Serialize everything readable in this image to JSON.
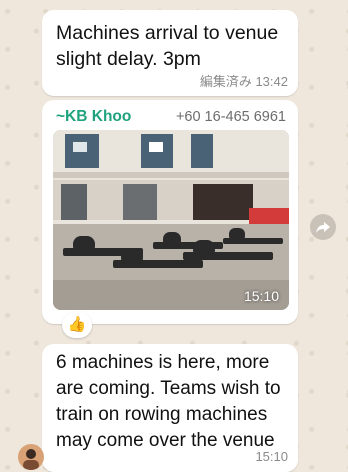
{
  "messages": [
    {
      "text": "Machines arrival to venue slight delay. 3pm",
      "edited_label": "編集済み",
      "time": "13:42"
    },
    {
      "sender": "~KB Khoo",
      "phone": "+60 16-465 6961",
      "image_time": "15:10",
      "reaction": "👍"
    },
    {
      "text": "6 machines is here, more are coming.  Teams wish to train on rowing machines may come over the venue",
      "time": "15:10"
    }
  ],
  "icons": {
    "forward": "forward-arrow-icon",
    "reaction": "thumbs-up-icon",
    "avatar": "sender-avatar"
  },
  "colors": {
    "chat_background": "#efe7dc",
    "bubble": "#ffffff",
    "sender_name": "#1fa37f",
    "meta_text": "#8a8a8a"
  }
}
